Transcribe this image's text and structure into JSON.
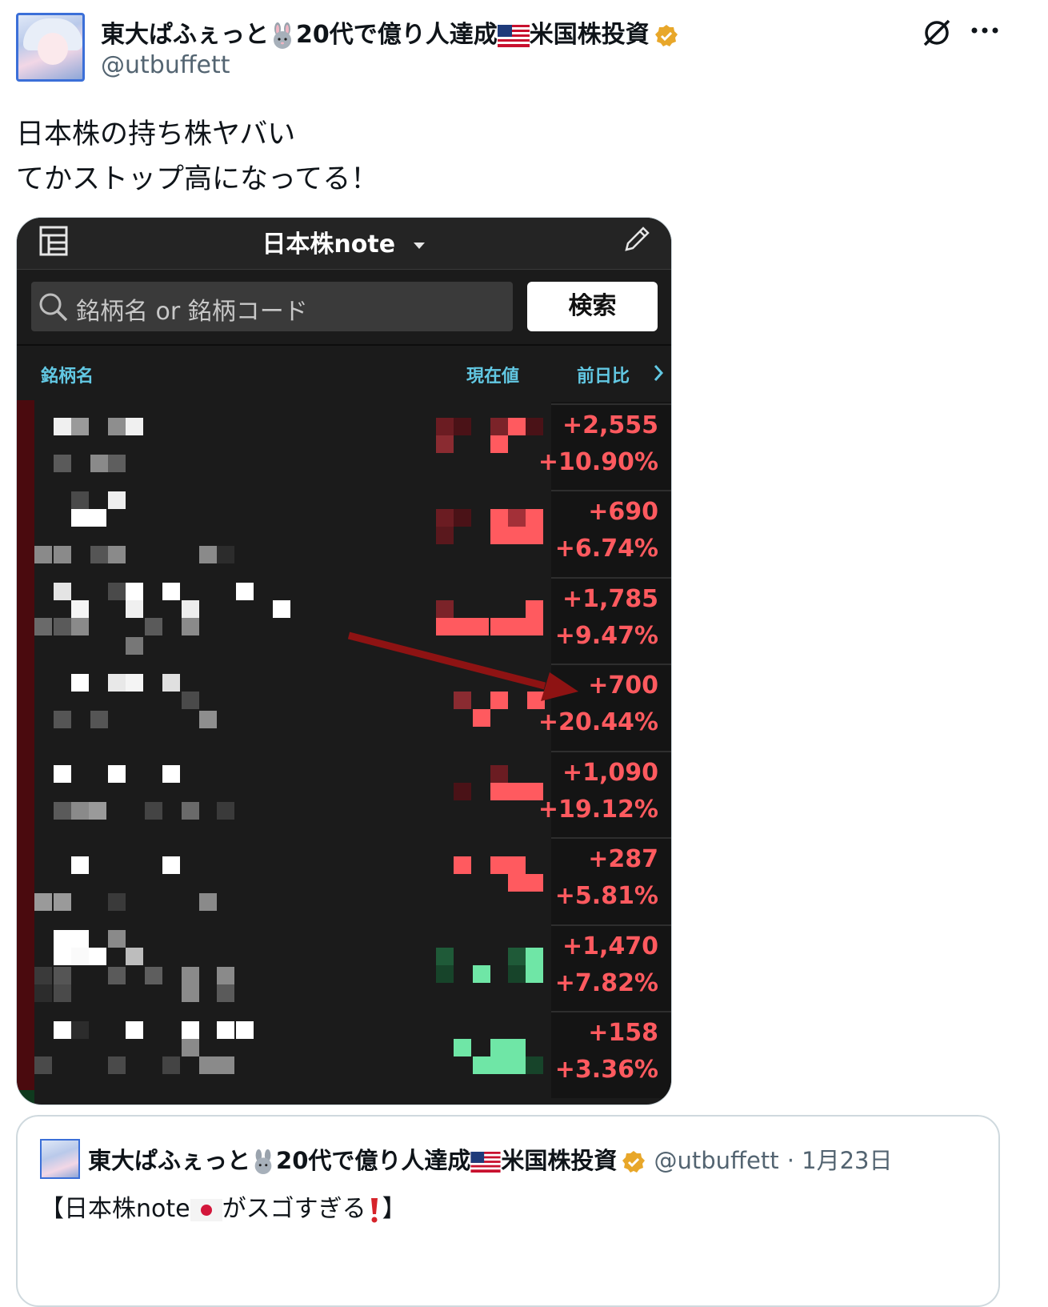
{
  "author": {
    "name_a": "東大ぱふぇっと",
    "name_b": "20代で億り人達成",
    "name_c": "米国株投資",
    "handle": "@utbuffett"
  },
  "tweet": {
    "line1": "日本株の持ち株ヤバい",
    "line2": "てかストップ高になってる！"
  },
  "app": {
    "title": "日本株note",
    "search_placeholder": "銘柄名 or 銘柄コード",
    "search_button": "検索",
    "col_name": "銘柄名",
    "col_price": "現在値",
    "col_change": "前日比"
  },
  "rows": [
    {
      "abs": "+2,555",
      "pct": "+10.90%",
      "color": "#ff5a5f"
    },
    {
      "abs": "+690",
      "pct": "+6.74%",
      "color": "#ff5a5f"
    },
    {
      "abs": "+1,785",
      "pct": "+9.47%",
      "color": "#ff5a5f"
    },
    {
      "abs": "+700",
      "pct": "+20.44%",
      "color": "#ff5a5f"
    },
    {
      "abs": "+1,090",
      "pct": "+19.12%",
      "color": "#ff5a5f"
    },
    {
      "abs": "+287",
      "pct": "+5.81%",
      "color": "#ff5a5f"
    },
    {
      "abs": "+1,470",
      "pct": "+7.82%",
      "color": "#ff5a5f"
    },
    {
      "abs": "+158",
      "pct": "+3.36%",
      "color": "#ff5a5f"
    }
  ],
  "quote": {
    "name_a": "東大ぱふぇっと",
    "name_b": "20代で億り人達成",
    "name_c": "米国株投資",
    "handle": "@utbuffett",
    "date": "· 1月23日",
    "text_a": "【日本株note",
    "text_b": "がスゴすぎる",
    "text_c": "】"
  },
  "icons": [
    "grok-icon",
    "more-icon",
    "verified-badge-icon",
    "rabbit-emoji",
    "us-flag-emoji",
    "jp-flag-emoji",
    "exclamation-emoji",
    "list-icon",
    "pencil-icon",
    "search-icon",
    "caret-down-icon",
    "chevron-right-icon",
    "red-arrow"
  ],
  "colors": {
    "accent_cyan": "#62c8e3",
    "up_red": "#ff5a5f",
    "verified_gold": "#e8a72a",
    "app_bg": "#1b1b1b"
  }
}
